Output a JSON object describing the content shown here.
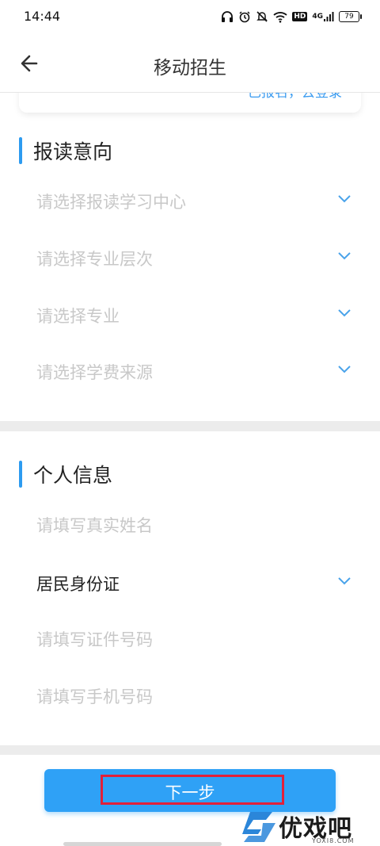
{
  "status_bar": {
    "time": "14:44",
    "network": "4G",
    "hd_label": "HD",
    "battery": "79",
    "icons": [
      "headphones-icon",
      "alarm-icon",
      "mute-icon",
      "wifi-icon",
      "hd-icon",
      "signal-icon",
      "battery-icon"
    ]
  },
  "header": {
    "title": "移动招生",
    "back_icon": "arrow-left-icon"
  },
  "top_card": {
    "link_text": "已报名，去登录"
  },
  "section_intent": {
    "title": "报读意向",
    "fields": [
      {
        "placeholder": "请选择报读学习中心",
        "type": "select"
      },
      {
        "placeholder": "请选择专业层次",
        "type": "select"
      },
      {
        "placeholder": "请选择专业",
        "type": "select"
      },
      {
        "placeholder": "请选择学费来源",
        "type": "select"
      }
    ]
  },
  "section_personal": {
    "title": "个人信息",
    "name_placeholder": "请填写真实姓名",
    "id_type_value": "居民身份证",
    "id_number_placeholder": "请填写证件号码",
    "phone_placeholder": "请填写手机号码"
  },
  "footer": {
    "next_label": "下一步"
  },
  "watermark": {
    "text": "优戏吧",
    "sub": "YOXI8.COM"
  },
  "colors": {
    "accent": "#2fa1f6",
    "section_bar": "#2d9bf0",
    "highlight": "#e2203a",
    "placeholder": "#c8c8c8"
  }
}
